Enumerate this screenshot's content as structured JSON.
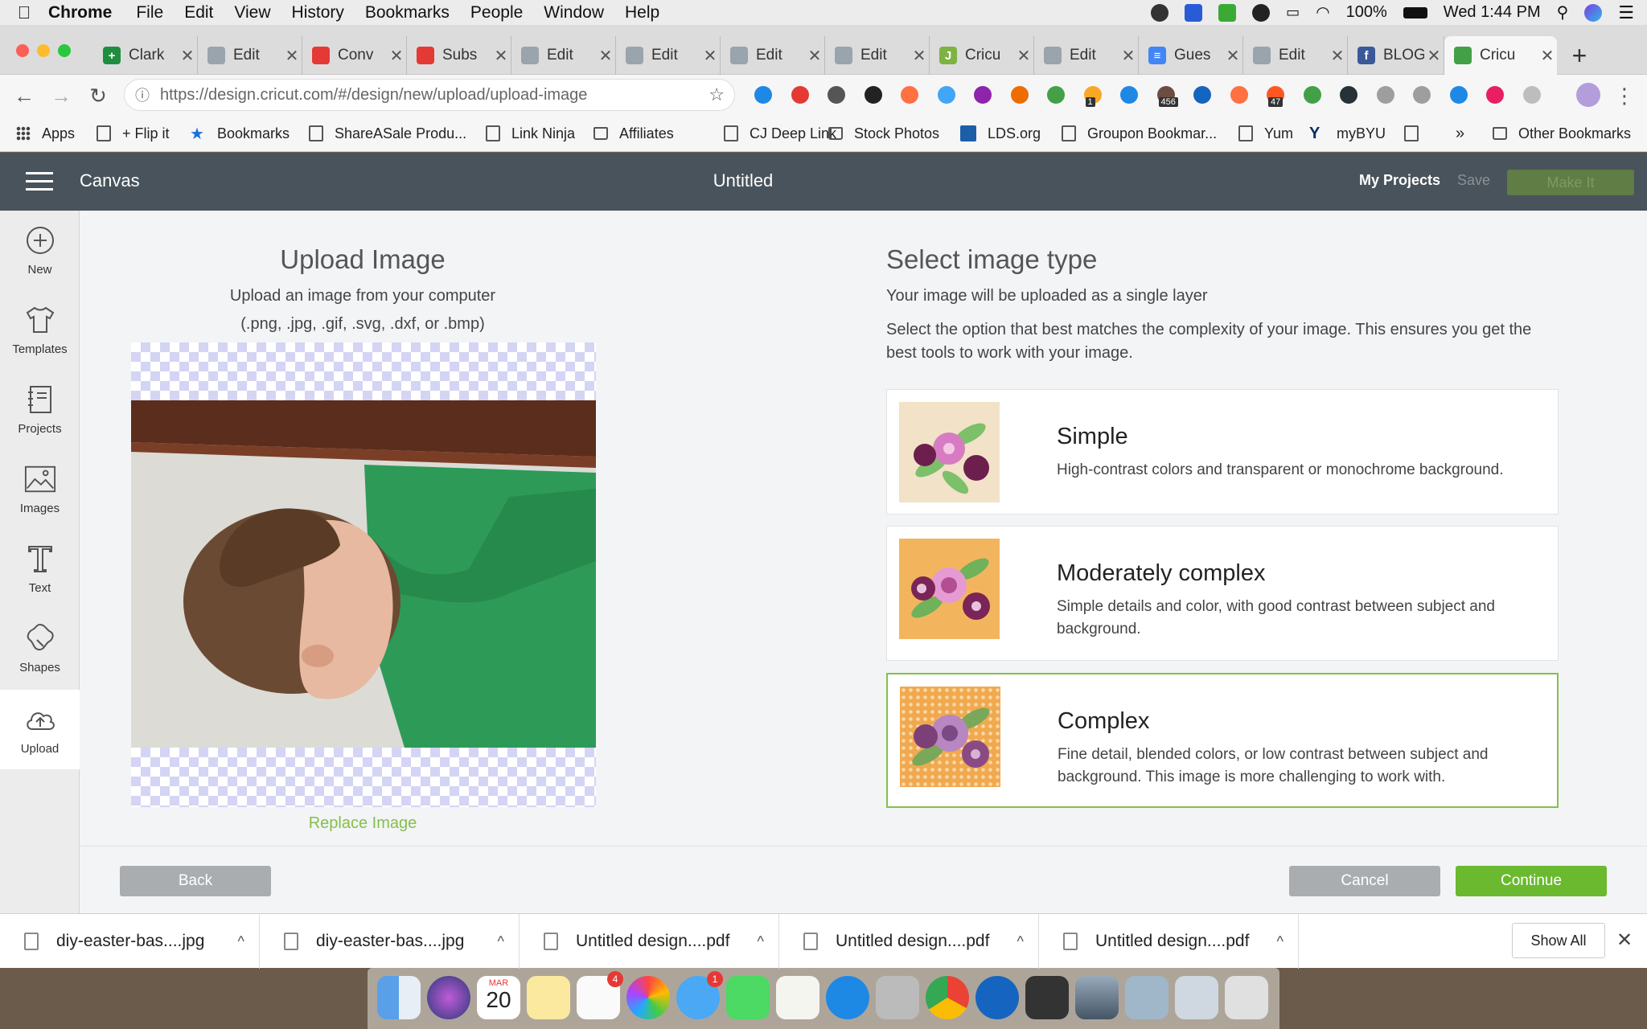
{
  "menubar": {
    "items": [
      "Chrome",
      "File",
      "Edit",
      "View",
      "History",
      "Bookmarks",
      "People",
      "Window",
      "Help"
    ],
    "battery": "100%",
    "clock": "Wed 1:44 PM"
  },
  "tabs": [
    {
      "label": "Clark",
      "color": "#1e8e3e",
      "glyph": "+"
    },
    {
      "label": "Edit",
      "color": "#9aa4ad",
      "glyph": ""
    },
    {
      "label": "Conv",
      "color": "#e53935",
      "glyph": ""
    },
    {
      "label": "Subs",
      "color": "#e53935",
      "glyph": ""
    },
    {
      "label": "Edit",
      "color": "#9aa4ad",
      "glyph": ""
    },
    {
      "label": "Edit",
      "color": "#9aa4ad",
      "glyph": ""
    },
    {
      "label": "Edit",
      "color": "#9aa4ad",
      "glyph": ""
    },
    {
      "label": "Edit",
      "color": "#9aa4ad",
      "glyph": ""
    },
    {
      "label": "Cricu",
      "color": "#7cb342",
      "glyph": "J"
    },
    {
      "label": "Edit",
      "color": "#9aa4ad",
      "glyph": ""
    },
    {
      "label": "Gues",
      "color": "#4285f4",
      "glyph": "≡"
    },
    {
      "label": "Edit",
      "color": "#9aa4ad",
      "glyph": ""
    },
    {
      "label": "BLOG",
      "color": "#3b5998",
      "glyph": "f"
    },
    {
      "label": "Cricu",
      "color": "#43a047",
      "glyph": ""
    }
  ],
  "address": {
    "url": "https://design.cricut.com/#/design/new/upload/upload-image",
    "ext_badges": [
      "1",
      "456",
      "47"
    ]
  },
  "bookmarks": [
    {
      "label": "Apps",
      "type": "apps"
    },
    {
      "label": "+ Flip it",
      "type": "page"
    },
    {
      "label": "Bookmarks",
      "type": "star"
    },
    {
      "label": "ShareASale Produ...",
      "type": "page"
    },
    {
      "label": "Link Ninja",
      "type": "page"
    },
    {
      "label": "Affiliates",
      "type": "folder"
    },
    {
      "label": "CJ Deep Link",
      "type": "page"
    },
    {
      "label": "Stock Photos",
      "type": "folder"
    },
    {
      "label": "LDS.org",
      "type": "image"
    },
    {
      "label": "Groupon Bookmar...",
      "type": "page"
    },
    {
      "label": "Yum",
      "type": "page"
    },
    {
      "label": "myBYU",
      "type": "byu"
    }
  ],
  "bookmarks_more": "»",
  "bookmarks_other": "Other Bookmarks",
  "app": {
    "brand": "Canvas",
    "project_title": "Untitled",
    "my_projects": "My Projects",
    "save": "Save",
    "make_it": "Make It"
  },
  "sidebar": [
    {
      "label": "New",
      "icon": "plus-circle-icon"
    },
    {
      "label": "Templates",
      "icon": "tshirt-icon"
    },
    {
      "label": "Projects",
      "icon": "notebook-icon"
    },
    {
      "label": "Images",
      "icon": "image-icon"
    },
    {
      "label": "Text",
      "icon": "text-t-icon"
    },
    {
      "label": "Shapes",
      "icon": "shapes-icon"
    },
    {
      "label": "Upload",
      "icon": "cloud-upload-icon"
    }
  ],
  "upload": {
    "title": "Upload Image",
    "subtitle": "Upload an image from your computer",
    "formats": "(.png, .jpg, .gif, .svg, .dxf, or .bmp)",
    "replace": "Replace Image"
  },
  "type_panel": {
    "title": "Select image type",
    "note": "Your image will be uploaded as a single layer",
    "instructions": "Select the option that best matches the complexity of your image. This ensures you get the best tools to work with your image.",
    "options": [
      {
        "title": "Simple",
        "desc": "High-contrast colors and transparent or monochrome background."
      },
      {
        "title": "Moderately complex",
        "desc": "Simple details and color, with good contrast between subject and background."
      },
      {
        "title": "Complex",
        "desc": "Fine detail, blended colors, or low contrast between subject and background. This image is more challenging to work with."
      }
    ],
    "selected_index": 2
  },
  "footer": {
    "back": "Back",
    "cancel": "Cancel",
    "continue": "Continue"
  },
  "downloads": {
    "items": [
      "diy-easter-bas....jpg",
      "diy-easter-bas....jpg",
      "Untitled design....pdf",
      "Untitled design....pdf",
      "Untitled design....pdf"
    ],
    "show_all": "Show All"
  },
  "dock": {
    "calendar_month": "MAR",
    "calendar_day": "20",
    "reminders_badge": "4",
    "messages_badge": "1"
  },
  "colors": {
    "accent_green": "#84c04a",
    "header": "#49535b",
    "continue": "#6ab92f"
  }
}
